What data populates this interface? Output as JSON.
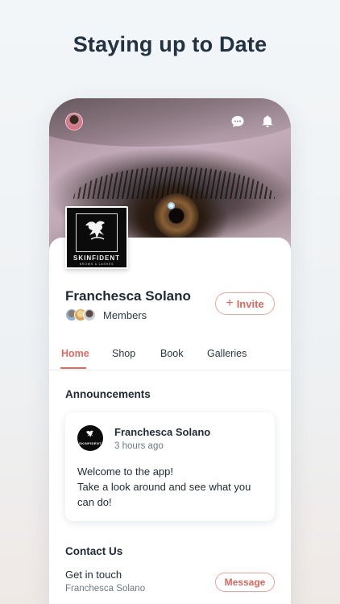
{
  "headline": "Staying up to Date",
  "icons": {
    "chat": "chat-bubble-icon",
    "notifications": "bell-icon",
    "invite": "plus-icon"
  },
  "colors": {
    "accent": "#e2695e",
    "accent_border": "#eea39c",
    "text_primary": "#1f2a36",
    "text_secondary": "#6f7a84"
  },
  "brand": {
    "name": "SKINFIDENT",
    "tagline": "BROWS & LASHES"
  },
  "profile": {
    "name": "Franchesca Solano",
    "members_label": "Members",
    "invite_label": "Invite"
  },
  "tabs": [
    {
      "label": "Home",
      "active": true
    },
    {
      "label": "Shop",
      "active": false
    },
    {
      "label": "Book",
      "active": false
    },
    {
      "label": "Galleries",
      "active": false
    }
  ],
  "announcements": {
    "title": "Announcements",
    "post": {
      "author": "Franchesca Solano",
      "time": "3 hours ago",
      "lines": [
        "Welcome to the app!",
        "Take a look around and see what you can do!"
      ]
    }
  },
  "contact": {
    "title": "Contact Us",
    "label": "Get in touch",
    "name": "Franchesca Solano",
    "button_label": "Message"
  }
}
